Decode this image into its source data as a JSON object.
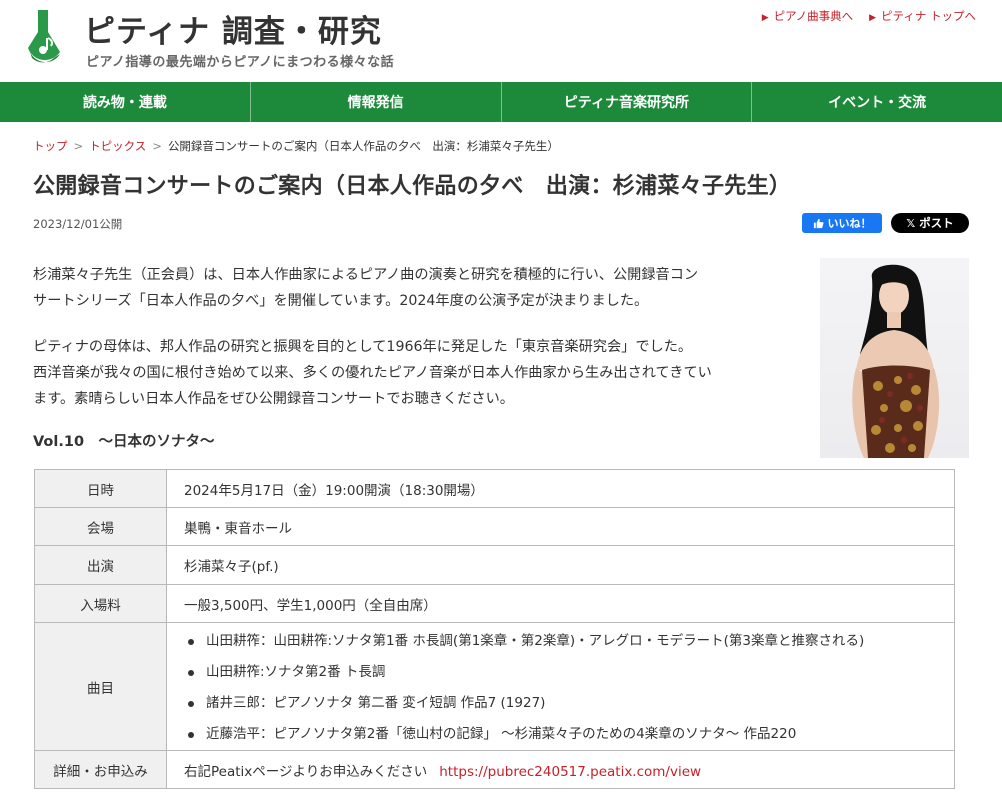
{
  "header": {
    "site_title": "ピティナ 調査・研究",
    "tagline": "ピアノ指導の最先端からピアノにまつわる様々な話",
    "top_links": [
      "ピアノ曲事典へ",
      "ピティナ トップへ"
    ]
  },
  "nav": {
    "items": [
      "読み物・連載",
      "情報発信",
      "ピティナ音楽研究所",
      "イベント・交流"
    ]
  },
  "breadcrumb": {
    "items": [
      "トップ",
      "トピックス",
      "公開録音コンサートのご案内（日本人作品の夕べ　出演：杉浦菜々子先生）"
    ],
    "separator": ">"
  },
  "article": {
    "title": "公開録音コンサートのご案内（日本人作品の夕べ　出演：杉浦菜々子先生）",
    "date": "2023/12/01公開",
    "paragraph1_line1": "杉浦菜々子先生（正会員）は、日本人作曲家によるピアノ曲の演奏と研究を積極的に行い、公開録音コン",
    "paragraph1_line2": "サートシリーズ「日本人作品の夕べ」を開催しています。2024年度の公演予定が決まりました。",
    "paragraph2_line1": "ピティナの母体は、邦人作品の研究と振興を目的として1966年に発足した「東京音楽研究会」でした。",
    "paragraph2_line2": "西洋音楽が我々の国に根付き始めて以来、多くの優れたピアノ音楽が日本人作曲家から生み出されてきてい",
    "paragraph2_line3": "ます。素晴らしい日本人作品をぜひ公開録音コンサートでお聴きください。",
    "section_heading": "Vol.10　～日本のソナタ～"
  },
  "social": {
    "like_label": "いいね！",
    "post_label": "ポスト"
  },
  "table": {
    "rows": [
      {
        "label": "日時",
        "value": "2024年5月17日（金）19:00開演（18:30開場）"
      },
      {
        "label": "会場",
        "value": "巣鴨・東音ホール"
      },
      {
        "label": "出演",
        "value": "杉浦菜々子(pf.)"
      },
      {
        "label": "入場料",
        "value": "一般3,500円、学生1,000円（全自由席）"
      }
    ],
    "program_label": "曲目",
    "program": [
      "山田耕筰：山田耕筰:ソナタ第1番 ホ長調(第1楽章・第2楽章)・アレグロ・モデラート(第3楽章と推察される)",
      "山田耕筰:ソナタ第2番 ト長調",
      "諸井三郎：ピアノソナタ 第二番 変イ短調 作品7 (1927)",
      "近藤浩平：ピアノソナタ第2番「徳山村の記録」 ～杉浦菜々子のための4楽章のソナタ～ 作品220"
    ],
    "details_label": "詳細・お申込み",
    "details_text": "右記Peatixページよりお申込みください",
    "details_url": "https://pubrec240517.peatix.com/view"
  },
  "colors": {
    "brand_green": "#1c8a3a",
    "link_red": "#c7202a",
    "facebook_blue": "#1877f2"
  }
}
